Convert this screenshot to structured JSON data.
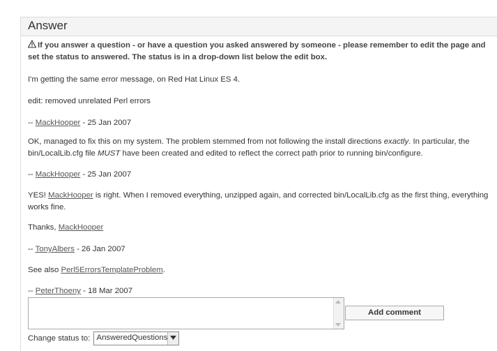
{
  "header": {
    "title": "Answer"
  },
  "notice": "If you answer a question - or have a question you asked answered by someone - please remember to edit the page and set the status to answered. The status is in a drop-down list below the edit box.",
  "comments": {
    "c1": "I'm getting the same error message, on Red Hat Linux ES 4.",
    "c2": "edit: removed unrelated Perl errors",
    "s1": {
      "prefix": "-- ",
      "user": "MackHooper",
      "date": " - 25 Jan 2007"
    },
    "c3": {
      "t1": "OK, managed to fix this on my system. The problem stemmed from not following the install directions ",
      "em1": "exactly",
      "t2": ". In particular, the bin/LocalLib.cfg file ",
      "em2": "MUST",
      "t3": " have been created and edited to reflect the correct path prior to running bin/configure."
    },
    "s2": {
      "prefix": "-- ",
      "user": "MackHooper",
      "date": " - 25 Jan 2007"
    },
    "c4": {
      "t1": "YES! ",
      "user": "MackHooper",
      "t2": " is right. When I removed everything, unzipped again, and corrected bin/LocalLib.cfg as the first thing, everything works fine."
    },
    "c5": {
      "t1": "Thanks, ",
      "user": "MackHooper"
    },
    "s3": {
      "prefix": "-- ",
      "user": "TonyAlbers",
      "date": " - 26 Jan 2007"
    },
    "c6": {
      "t1": "See also ",
      "link": "Perl5ErrorsTemplateProblem",
      "t2": "."
    },
    "s4": {
      "prefix": "-- ",
      "user": "PeterThoeny",
      "date": " - 18 Mar 2007"
    }
  },
  "form": {
    "add_comment_label": "Add comment",
    "status_label": "Change status to:",
    "status_value": "AnsweredQuestions"
  }
}
